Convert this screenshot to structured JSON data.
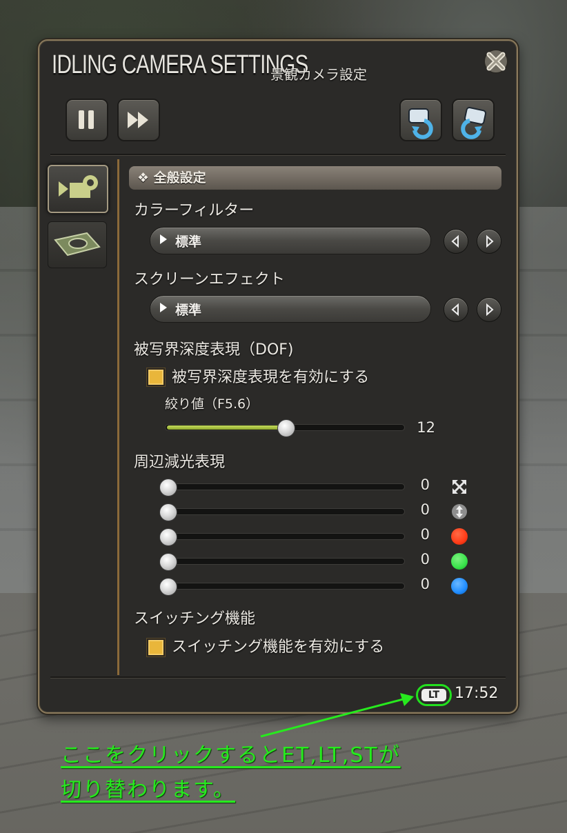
{
  "window": {
    "title": "IDLING CAMERA SETTINGS",
    "subtitle": "景観カメラ設定"
  },
  "toolbar": {
    "pause_icon": "pause-icon",
    "fast_forward_icon": "fast-forward-icon",
    "rotate_left_icon": "camera-rotate-left-icon",
    "rotate_right_icon": "camera-rotate-right-icon"
  },
  "sidebar": {
    "tabs": [
      {
        "icon": "camera-settings-icon",
        "active": true
      },
      {
        "icon": "layer-frame-icon",
        "active": false
      }
    ]
  },
  "section": {
    "header": "❖ 全般設定"
  },
  "color_filter": {
    "label": "カラーフィルター",
    "value": "標準"
  },
  "screen_effect": {
    "label": "スクリーンエフェクト",
    "value": "標準"
  },
  "dof": {
    "label": "被写界深度表現（DOF)",
    "checkbox_label": "被写界深度表現を有効にする",
    "checked": true,
    "aperture_label": "絞り値（F5.6）",
    "aperture_value": "12",
    "aperture_fraction": 0.5
  },
  "vignette": {
    "label": "周辺減光表現",
    "sliders": [
      {
        "value": "0",
        "icon": "expand-icon"
      },
      {
        "value": "0",
        "icon": "vertical-resize-icon"
      },
      {
        "value": "0",
        "icon": "red-dot-icon"
      },
      {
        "value": "0",
        "icon": "green-dot-icon"
      },
      {
        "value": "0",
        "icon": "blue-dot-icon"
      }
    ]
  },
  "switching": {
    "label": "スイッチング機能",
    "checkbox_label": "スイッチング機能を有効にする",
    "checked": true
  },
  "footer": {
    "time_mode": "LT",
    "clock": "17:52"
  },
  "annotation": {
    "line1": "ここをクリックするとET,LT,STが",
    "line2": "切り替わります。"
  },
  "colors": {
    "accent_checkbox": "#e9b63b",
    "annotation_green": "#27ea1e",
    "dot_red": "#ff3b17",
    "dot_green": "#38e34a",
    "dot_blue": "#1f8cff"
  }
}
